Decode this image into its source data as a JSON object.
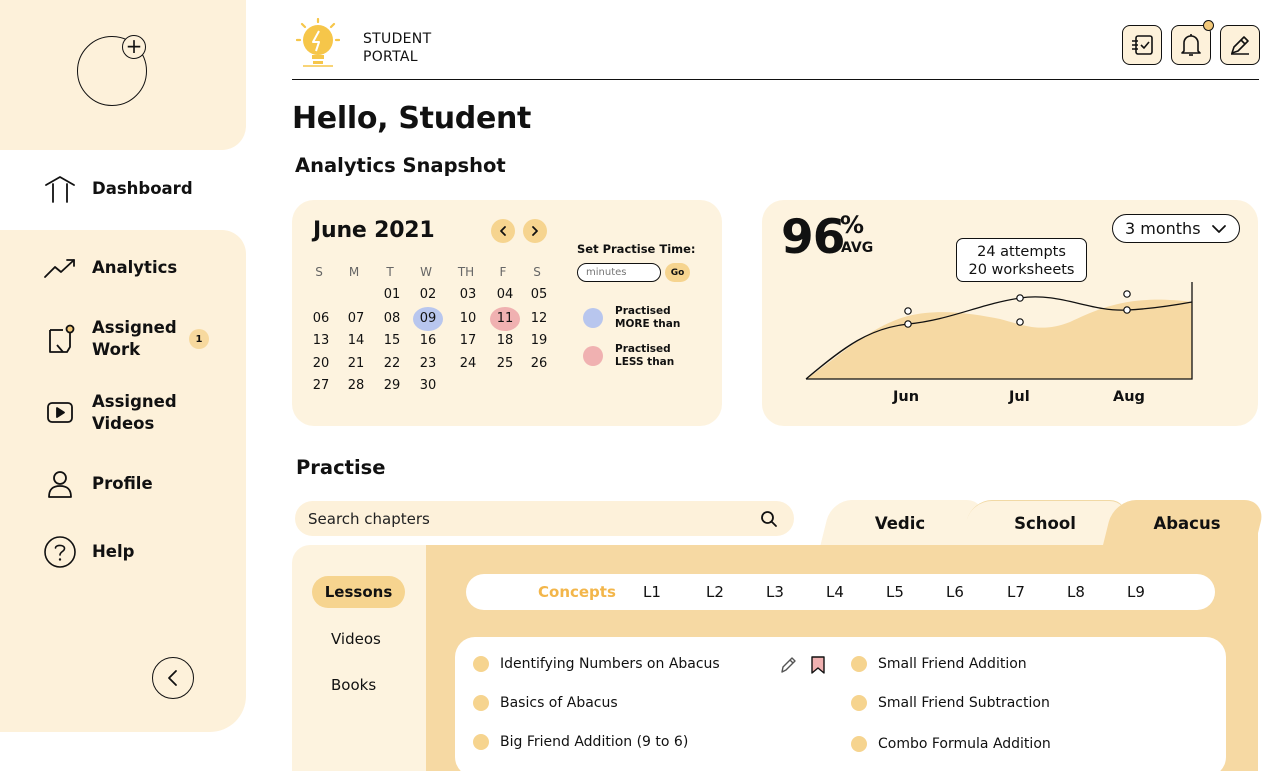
{
  "app": {
    "brand": "STUDENT\nPORTAL"
  },
  "sidebar": {
    "items": [
      {
        "label": "Dashboard",
        "icon": "home-icon"
      },
      {
        "label": "Analytics",
        "icon": "trending-up-icon"
      },
      {
        "label": "Assigned\nWork",
        "icon": "assignment-icon",
        "badge": "1"
      },
      {
        "label": "Assigned\nVideos",
        "icon": "video-icon"
      },
      {
        "label": "Profile",
        "icon": "user-icon"
      },
      {
        "label": "Help",
        "icon": "help-icon"
      }
    ]
  },
  "header": {
    "icons": [
      "checklist-icon",
      "bell-icon",
      "edit-icon"
    ]
  },
  "greeting": "Hello, Student",
  "analytics_title": "Analytics Snapshot",
  "calendar": {
    "month": "June 2021",
    "weekdays": [
      "S",
      "M",
      "T",
      "W",
      "TH",
      "F",
      "S"
    ],
    "weeks": [
      [
        "",
        "",
        "01",
        "02",
        "03",
        "04",
        "05"
      ],
      [
        "06",
        "07",
        "08",
        "09",
        "10",
        "11",
        "12"
      ],
      [
        "13",
        "14",
        "15",
        "16",
        "17",
        "18",
        "19"
      ],
      [
        "20",
        "21",
        "22",
        "23",
        "24",
        "25",
        "26"
      ],
      [
        "27",
        "28",
        "29",
        "30",
        "",
        "",
        ""
      ]
    ],
    "highlight_more": "09",
    "highlight_less": "11",
    "set_time_label": "Set Practise Time:",
    "input_placeholder": "minutes",
    "go_label": "Go",
    "legend_more": "Practised\nMORE than",
    "legend_less": "Practised\nLESS than",
    "color_more": "#b8c6ee",
    "color_less": "#f0b1b1"
  },
  "stats": {
    "value": "96",
    "unit": "%",
    "avg_label": "AVG",
    "period": "3 months",
    "tooltip": "24 attempts\n20 worksheets",
    "months": [
      "Jun",
      "Jul",
      "Aug"
    ]
  },
  "practise": {
    "title": "Practise",
    "search_placeholder": "Search chapters",
    "tabs": [
      "Vedic",
      "School",
      "Abacus"
    ],
    "active_tab": "Abacus",
    "side_tabs": [
      "Lessons",
      "Videos",
      "Books"
    ],
    "levels": [
      "Concepts",
      "L1",
      "L2",
      "L3",
      "L4",
      "L5",
      "L6",
      "L7",
      "L8",
      "L9"
    ],
    "lessons_left": [
      "Identifying Numbers on Abacus",
      "Basics of Abacus",
      "Big Friend Addition (9 to 6)"
    ],
    "lessons_right": [
      "Small Friend Addition",
      "Small Friend Subtraction",
      "Combo Formula Addition"
    ]
  },
  "colors": {
    "accent": "#f6d48f",
    "panel": "#fdf3df",
    "sidebar": "#fdf1da",
    "chart_fill": "#f6d9a3"
  }
}
